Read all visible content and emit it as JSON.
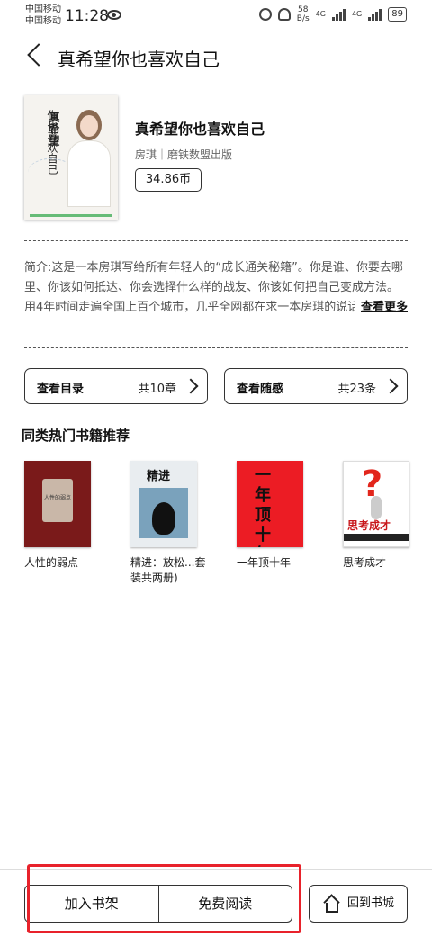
{
  "status_bar": {
    "carrier1": "中国移动",
    "carrier2": "中国移动",
    "time": "11:28",
    "speed": "58",
    "speed_unit": "B/s",
    "net1": "4G",
    "net2": "4G",
    "battery": "89"
  },
  "header": {
    "title": "真希望你也喜欢自己"
  },
  "book": {
    "cover_title_a": "你也喜欢自己",
    "cover_title_b": "真希望",
    "title": "真希望你也喜欢自己",
    "meta": "房琪｜磨铁数盟出版",
    "price": "34.86币"
  },
  "intro": {
    "text": "简介:这是一本房琪写给所有年轻人的“成长通关秘籍”。你是谁、你要去哪里、你该如何抵达、你会选择什么样的战友、你该如何把自己变成方法。用4年时间走遍全国上百个城市，几乎全网都在求一本房琪的说话之道和文案心法。但真的有那些秘诀吗？有技巧更是心法，有...",
    "more": "查看更多"
  },
  "catalog": {
    "label": "查看目录",
    "count": "共10章"
  },
  "notes": {
    "label": "查看随感",
    "count": "共23条"
  },
  "recommend": {
    "title": "同类热门书籍推荐",
    "books": [
      {
        "title": "人性的弱点",
        "cover_text": "人性的弱点"
      },
      {
        "title": "精进：放松...套装共两册)",
        "cover_text": "精进"
      },
      {
        "title": "一年顶十年",
        "cover_text": "一年顶十年"
      },
      {
        "title": "思考成才",
        "cover_text": "思考成才"
      }
    ]
  },
  "bottom": {
    "add_shelf": "加入书架",
    "free_read": "免费阅读",
    "back_store": "回到书城"
  },
  "colors": {
    "highlight": "#e8222b"
  }
}
